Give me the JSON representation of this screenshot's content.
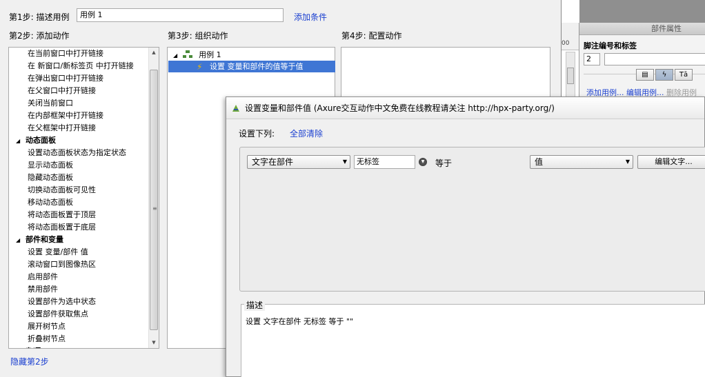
{
  "background": {
    "ruler_number": "00",
    "props_panel": {
      "title": "部件属性",
      "section_label": "脚注编号和标签",
      "footnote_number": "2",
      "tab_icons": [
        "note-icon",
        "interaction-icon",
        "text-style-icon"
      ],
      "tab_glyphs": [
        "▤",
        "ϟ",
        "Tā"
      ],
      "links": {
        "add_case": "添加用例...",
        "edit_case": "编辑用例...",
        "delete_case": "删除用例"
      }
    }
  },
  "case_editor": {
    "step1_label": "第1步: 描述用例",
    "case_name": "用例 1",
    "add_condition": "添加条件",
    "step2_label": "第2步: 添加动作",
    "step3_label": "第3步: 组织动作",
    "step4_label": "第4步: 配置动作",
    "hide_step2": "隐藏第2步",
    "actions": [
      {
        "type": "item",
        "label": "在当前窗口中打开链接"
      },
      {
        "type": "item",
        "label": "在 新窗口/新标签页 中打开链接"
      },
      {
        "type": "item",
        "label": "在弹出窗口中打开链接"
      },
      {
        "type": "item",
        "label": "在父窗口中打开链接"
      },
      {
        "type": "item",
        "label": "关闭当前窗口"
      },
      {
        "type": "item",
        "label": "在内部框架中打开链接"
      },
      {
        "type": "item",
        "label": "在父框架中打开链接"
      },
      {
        "type": "category",
        "label": "动态面板"
      },
      {
        "type": "item",
        "label": "设置动态面板状态为指定状态"
      },
      {
        "type": "item",
        "label": "显示动态面板"
      },
      {
        "type": "item",
        "label": "隐藏动态面板"
      },
      {
        "type": "item",
        "label": "切换动态面板可见性"
      },
      {
        "type": "item",
        "label": "移动动态面板"
      },
      {
        "type": "item",
        "label": "将动态面板置于顶层"
      },
      {
        "type": "item",
        "label": "将动态面板置于底层"
      },
      {
        "type": "category",
        "label": "部件和变量"
      },
      {
        "type": "item",
        "label": "设置 变量/部件 值"
      },
      {
        "type": "item",
        "label": "滚动窗口到图像热区"
      },
      {
        "type": "item",
        "label": "启用部件"
      },
      {
        "type": "item",
        "label": "禁用部件"
      },
      {
        "type": "item",
        "label": "设置部件为选中状态"
      },
      {
        "type": "item",
        "label": "设置部件获取焦点"
      },
      {
        "type": "item",
        "label": "展开树节点"
      },
      {
        "type": "item",
        "label": "折叠树节点"
      },
      {
        "type": "category",
        "label": "杂项"
      }
    ],
    "organize": {
      "case_label": "用例 1",
      "action_label": "设置 变量和部件的值等于值"
    }
  },
  "set_variable_dialog": {
    "title": "设置变量和部件值 (Axure交互动作中文免费在线教程请关注 http://hpx-party.org/)",
    "set_list_label": "设置下列:",
    "clear_all": "全部清除",
    "target_type": "文字在部件",
    "widget_name": "无标签",
    "equals_label": "等于",
    "value_type": "值",
    "edit_text_button": "编辑文字...",
    "description_label": "描述",
    "description_text": "设置 文字在部件 无标签 等于 \"\""
  }
}
